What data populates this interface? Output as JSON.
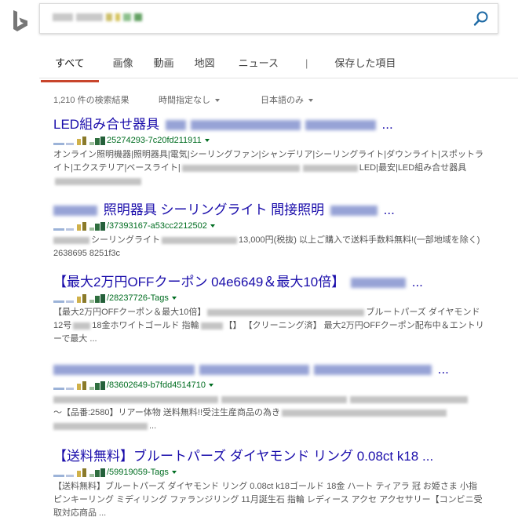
{
  "search": {
    "query": "",
    "placeholder": ""
  },
  "tabs": [
    {
      "label": "すべて"
    },
    {
      "label": "画像"
    },
    {
      "label": "動画"
    },
    {
      "label": "地図"
    },
    {
      "label": "ニュース"
    },
    {
      "label": "|"
    },
    {
      "label": "保存した項目"
    }
  ],
  "filters": {
    "result_count": "1,210 件の検索結果",
    "time_filter": "時間指定なし",
    "language_filter": "日本語のみ"
  },
  "results": [
    {
      "title": "LED組み合せ器具",
      "title_tail": "...",
      "cite": "25274293-7c20fd211911",
      "snippet_a": "オンライン照明機器|照明器具|電気|シーリングファン|シャンデリア|シーリングライト|ダウンライト|スポットライト|エクステリア|ベースライト|",
      "snippet_b": "LED|最安|LED組み合せ器具"
    },
    {
      "title": "照明器具 シーリングライト 間接照明",
      "title_tail": "...",
      "cite": "/37393167-a53cc2212502",
      "snippet_a": "シーリングライト",
      "snippet_b": "13,000円(税抜) 以上ご購入で送料手数料無料!(一部地域を除く) 2638695 8251f3c"
    },
    {
      "title": "【最大2万円OFFクーポン 04e6649＆最大10倍】",
      "title_tail": "...",
      "cite": "/28237726-Tags",
      "snippet_a": "【最大2万円OFFクーポン＆最大10倍】",
      "snippet_b": "ブルートパーズ ダイヤモンド 12号",
      "snippet_c": "18金ホワイトゴールド 指輪",
      "snippet_d": "【】 【クリーニング済】 最大2万円OFFクーポン配布中＆エントリーで最大 ..."
    },
    {
      "title_tail": "...",
      "cite": "/83602649-b7fdd4514710",
      "snippet_a": "～【品番:2580】リアー体物 送料無料!!受注生産商品の為き",
      "snippet_b": "..."
    },
    {
      "title": "【送料無料】ブルートパーズ ダイヤモンド リング 0.08ct k18",
      "title_tail": "...",
      "cite": "/59919059-Tags",
      "snippet_a": "【送料無料】ブルートパーズ ダイヤモンド リング 0.08ct k18ゴールド 18金 ハート ティアラ 冠 お姫さま 小指 ピンキーリング ミディリング ファランジリング 11月誕生石 指輪 レディース アクセ アクセサリー【コンビニ受取対応商品 ..."
    }
  ],
  "colors": {
    "link": "#1a0dab",
    "cite": "#006d21",
    "tab_active": "#c8452c",
    "search_icon": "#1e6aa5"
  }
}
